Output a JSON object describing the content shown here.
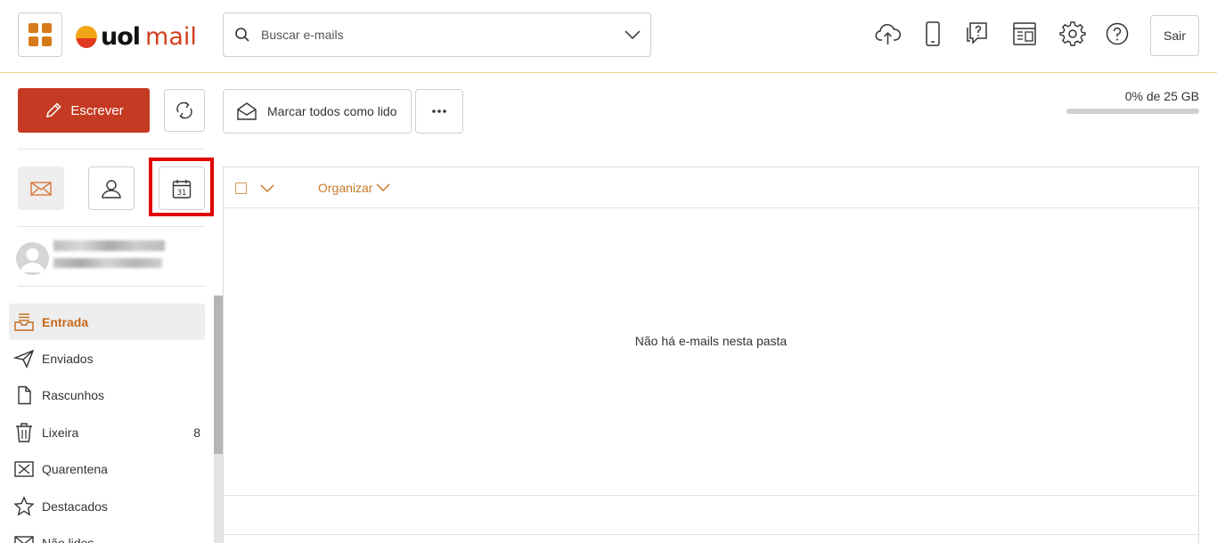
{
  "header": {
    "search_placeholder": "Buscar e-mails",
    "logout_label": "Sair",
    "logo": {
      "brand": "uol",
      "product": "mail"
    }
  },
  "toolbar": {
    "compose_label": "Escrever",
    "mark_all_read_label": "Marcar todos como lido",
    "more_label": "•••"
  },
  "quota": {
    "text": "0% de 25 GB",
    "percent": 0
  },
  "list": {
    "organize_label": "Organizar",
    "empty_message": "Não há e-mails nesta pasta"
  },
  "folders": [
    {
      "label": "Entrada",
      "icon": "inbox-icon",
      "active": true
    },
    {
      "label": "Enviados",
      "icon": "send-icon"
    },
    {
      "label": "Rascunhos",
      "icon": "draft-icon"
    },
    {
      "label": "Lixeira",
      "icon": "trash-icon",
      "count": "8"
    },
    {
      "label": "Quarentena",
      "icon": "quarantine-icon"
    },
    {
      "label": "Destacados",
      "icon": "star-icon"
    },
    {
      "label": "Não lidos",
      "icon": "unread-icon"
    }
  ],
  "calendar_icon_day": "31",
  "colors": {
    "accent": "#c53a22",
    "orange_text": "#c97a26",
    "highlight": "#e00000"
  }
}
